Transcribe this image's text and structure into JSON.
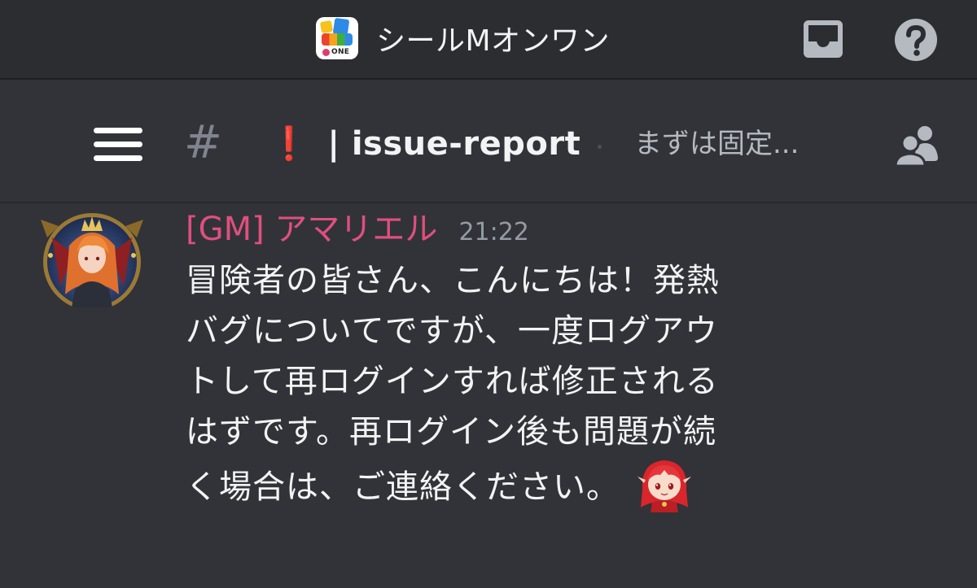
{
  "server": {
    "title": "シールMオンワン",
    "logo_text": "ONE",
    "icons": {
      "inbox": "inbox-icon",
      "help": "help-icon"
    }
  },
  "channel": {
    "menu_icon": "hamburger-menu-icon",
    "hash_symbol": "#",
    "prefix_emoji": "❗",
    "name": "| issue-report",
    "topic": "まずは固定...",
    "members_icon": "members-icon"
  },
  "message": {
    "author": "[GM] アマリエル",
    "timestamp": "21:22",
    "lines": [
      "冒険者の皆さん、こんにちは！発熱",
      "バグについてですが、一度ログアウ",
      "トして再ログインすれば修正される",
      "はずです。再ログイン後も問題が続",
      "く場合は、ご連絡ください。"
    ],
    "emoji": "chibi-character-emoji"
  },
  "colors": {
    "background": "#313338",
    "server_bar": "#2b2d31",
    "author": "#e04f7e",
    "alert_red": "#e53935",
    "muted_text": "#949ba4"
  }
}
